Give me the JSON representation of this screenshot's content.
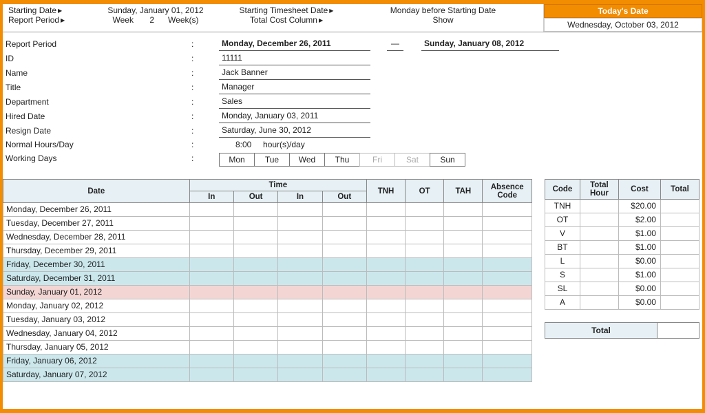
{
  "header": {
    "starting_date_label": "Starting Date",
    "starting_date_value": "Sunday, January 01, 2012",
    "report_period_label": "Report Period",
    "week_label": "Week",
    "week_value": "2",
    "weeks_label": "Week(s)",
    "starting_ts_label": "Starting Timesheet Date",
    "starting_ts_value": "Monday before Starting Date",
    "total_cost_label": "Total Cost Column",
    "total_cost_value": "Show",
    "todays_date_label": "Today's Date",
    "todays_date_value": "Wednesday, October 03, 2012"
  },
  "info": {
    "report_period_label": "Report Period",
    "report_period_from": "Monday, December 26, 2011",
    "report_period_to": "Sunday, January 08, 2012",
    "id_label": "ID",
    "id_value": "11111",
    "name_label": "Name",
    "name_value": "Jack Banner",
    "title_label": "Title",
    "title_value": "Manager",
    "dept_label": "Department",
    "dept_value": "Sales",
    "hired_label": "Hired Date",
    "hired_value": "Monday, January 03, 2011",
    "resign_label": "Resign Date",
    "resign_value": "Saturday, June 30, 2012",
    "hours_label": "Normal Hours/Day",
    "hours_value": "8:00",
    "hours_unit": "hour(s)/day",
    "working_days_label": "Working Days",
    "days": [
      {
        "label": "Mon",
        "on": true
      },
      {
        "label": "Tue",
        "on": true
      },
      {
        "label": "Wed",
        "on": true
      },
      {
        "label": "Thu",
        "on": true
      },
      {
        "label": "Fri",
        "on": false
      },
      {
        "label": "Sat",
        "on": false
      },
      {
        "label": "Sun",
        "on": true
      }
    ]
  },
  "timesheet": {
    "headers": {
      "date": "Date",
      "time": "Time",
      "in": "In",
      "out": "Out",
      "tnh": "TNH",
      "ot": "OT",
      "tah": "TAH",
      "absence": "Absence Code"
    },
    "rows": [
      {
        "date": "Monday, December 26, 2011",
        "cls": ""
      },
      {
        "date": "Tuesday, December 27, 2011",
        "cls": ""
      },
      {
        "date": "Wednesday, December 28, 2011",
        "cls": ""
      },
      {
        "date": "Thursday, December 29, 2011",
        "cls": ""
      },
      {
        "date": "Friday, December 30, 2011",
        "cls": "row-weekend"
      },
      {
        "date": "Saturday, December 31, 2011",
        "cls": "row-weekend"
      },
      {
        "date": "Sunday, January 01, 2012",
        "cls": "row-sunday"
      },
      {
        "date": "Monday, January 02, 2012",
        "cls": ""
      },
      {
        "date": "Tuesday, January 03, 2012",
        "cls": ""
      },
      {
        "date": "Wednesday, January 04, 2012",
        "cls": ""
      },
      {
        "date": "Thursday, January 05, 2012",
        "cls": ""
      },
      {
        "date": "Friday, January 06, 2012",
        "cls": "row-weekend"
      },
      {
        "date": "Saturday, January 07, 2012",
        "cls": "row-weekend"
      }
    ]
  },
  "codes": {
    "headers": {
      "code": "Code",
      "total_hour": "Total Hour",
      "cost": "Cost",
      "total": "Total"
    },
    "rows": [
      {
        "code": "TNH",
        "cost": "$20.00"
      },
      {
        "code": "OT",
        "cost": "$2.00"
      },
      {
        "code": "V",
        "cost": "$1.00"
      },
      {
        "code": "BT",
        "cost": "$1.00"
      },
      {
        "code": "L",
        "cost": "$0.00"
      },
      {
        "code": "S",
        "cost": "$1.00"
      },
      {
        "code": "SL",
        "cost": "$0.00"
      },
      {
        "code": "A",
        "cost": "$0.00"
      }
    ],
    "total_label": "Total"
  }
}
